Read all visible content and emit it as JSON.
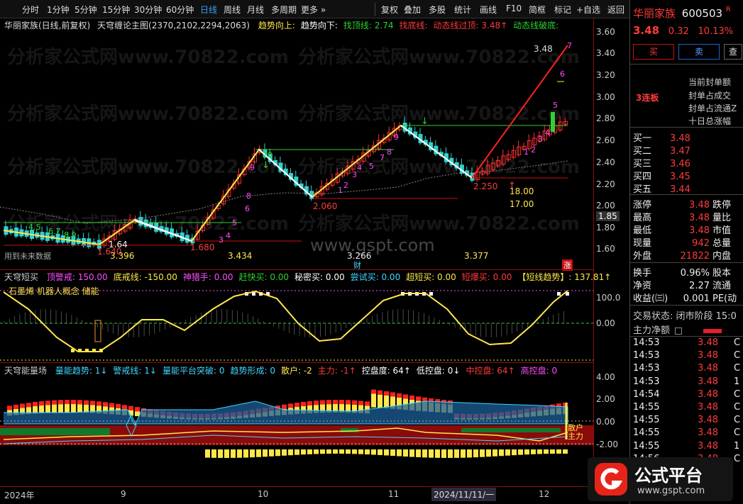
{
  "toolbar": {
    "periods": [
      "分时",
      "1分钟",
      "5分钟",
      "15分钟",
      "30分钟",
      "60分钟",
      "日线",
      "周线",
      "月线",
      "多周期",
      "更多 »"
    ],
    "active_period": "日线",
    "right_buttons": [
      "复权",
      "叠加",
      "多股",
      "统计",
      "画线",
      "F10",
      "简框",
      "标记",
      "+自选",
      "返回"
    ]
  },
  "main_chart": {
    "header": "华丽家族(日线,前复权)",
    "indicator_title": "天穹缠论主图(2370,2102,2294,2063)",
    "items": [
      {
        "text": "趋势向上:",
        "color": "#ffe74a"
      },
      {
        "text": "趋势向下:",
        "color": "#ffffff"
      },
      {
        "text": "找顶线: 2.74",
        "color": "#2fd12f"
      },
      {
        "text": "找底线:",
        "color": "#ff3b3b"
      },
      {
        "text": "动态线过顶: 3.48↑",
        "color": "#ff3b3b"
      },
      {
        "text": "动态线破底:",
        "color": "#2fd12f"
      }
    ],
    "y_ticks": [
      "3.60",
      "3.40",
      "3.20",
      "3.00",
      "2.80",
      "2.60",
      "2.40",
      "2.20",
      "2.00",
      "1.80",
      "1.60"
    ],
    "current_price_tag": "1.85",
    "annotations": {
      "high_348": "3.48",
      "p_220": "2.20",
      "p_2250": "2.250",
      "p_2060": "2.060",
      "p_1680": "1.680",
      "p_164": "1.64",
      "p_1640": "1.640",
      "target1": "18.00",
      "target2": "17.00",
      "v_3396": "3.396",
      "v_3434": "3.434",
      "v_3266": "3.266",
      "v_3377": "3.377",
      "cai": "财",
      "future_data": "用到未来数据",
      "zhangting": "涨"
    },
    "watermark_url": "www.gspt.com"
  },
  "chart_data": [
    {
      "type": "line",
      "title": "天穹缠论主图",
      "series": [
        {
          "name": "趋势向上",
          "x": [
            "9",
            "10",
            "11",
            "12"
          ],
          "values": [
            2.55,
            2.06,
            2.73,
            3.48
          ]
        }
      ],
      "ylim": [
        1.55,
        3.65
      ]
    },
    {
      "type": "line",
      "title": "天穹短买",
      "ylim": [
        -20,
        140
      ],
      "x": [
        "9",
        "10",
        "11",
        "12"
      ],
      "series": [
        {
          "name": "天穹短买",
          "values": [
            0,
            100,
            30,
            100
          ]
        }
      ]
    },
    {
      "type": "bar",
      "title": "天穹能量场",
      "ylim": [
        -3,
        4.5
      ],
      "x": [
        "9",
        "10",
        "11",
        "12"
      ],
      "series": [
        {
          "name": "天穹能量场",
          "values": [
            0.9,
            1.4,
            3.2,
            0.8
          ]
        }
      ]
    }
  ],
  "sub1": {
    "title": "天穹短买",
    "items": [
      {
        "text": "顶警戒: 150.00",
        "color": "#ff4dff"
      },
      {
        "text": "底戒线: -150.00",
        "color": "#ffe74a"
      },
      {
        "text": "神猎手: 0.00",
        "color": "#ff4dff"
      },
      {
        "text": "赶快买: 0.00",
        "color": "#2fd12f"
      },
      {
        "text": "秘密买: 0.00",
        "color": "#ffffff"
      },
      {
        "text": "尝试买: 0.00",
        "color": "#3fd7ff"
      },
      {
        "text": "超短买: 0.00",
        "color": "#ffe74a"
      },
      {
        "text": "短爆买: 0.00",
        "color": "#ff3b3b"
      },
      {
        "text": "【短线趋势】: 137.81↑",
        "color": "#ffe74a"
      }
    ],
    "tag": "石墨烯 机器人概念 储能",
    "y_ticks": [
      "100.0",
      "0.00"
    ]
  },
  "sub2": {
    "title": "天穹能量场",
    "items": [
      {
        "text": "量能趋势: 1↓",
        "color": "#3fd7ff"
      },
      {
        "text": "警戒线: 1↓",
        "color": "#3fd7ff"
      },
      {
        "text": "量能平台突破: 0",
        "color": "#3fd7ff"
      },
      {
        "text": "趋势形成: 0",
        "color": "#3fd7ff"
      },
      {
        "text": "散户: -2",
        "color": "#ffe74a"
      },
      {
        "text": "主力: -1↑",
        "color": "#ff3b3b"
      },
      {
        "text": "控盘度: 64↑",
        "color": "#ffffff"
      },
      {
        "text": "低控盘: 0↓",
        "color": "#ffffff"
      },
      {
        "text": "中控盘: 64↑",
        "color": "#ff3b3b"
      },
      {
        "text": "高控盘: 0",
        "color": "#ff4dff"
      }
    ],
    "y_ticks": [
      "4.00",
      "2.00",
      "0.00",
      "-2.00"
    ],
    "side_labels": "散户 主力"
  },
  "xaxis": {
    "labels": [
      "2024年",
      "9",
      "10",
      "11",
      "2024/11/11/一",
      "12"
    ]
  },
  "rpanel": {
    "stock_name": "华丽家族",
    "stock_code": "600503",
    "r_badge": "R",
    "price": "3.48",
    "change": "0.32",
    "pct": "10.13%",
    "buy_label": "买",
    "sell_label": "卖",
    "other_label": "查",
    "limit_info": [
      "当前封单额",
      "封单占成交",
      "封单占流通Z",
      "十日总涨幅"
    ],
    "lianban": "3连板",
    "bid": [
      {
        "label": "买一",
        "price": "3.48"
      },
      {
        "label": "买二",
        "price": "3.47"
      },
      {
        "label": "买三",
        "price": "3.46"
      },
      {
        "label": "买四",
        "price": "3.45"
      },
      {
        "label": "买五",
        "price": "3.44"
      }
    ],
    "stats": [
      {
        "label": "涨停",
        "value": "3.48",
        "label2": "跌停"
      },
      {
        "label": "最高",
        "value": "3.48",
        "label2": "量比"
      },
      {
        "label": "最低",
        "value": "3.48",
        "label2": "市值"
      },
      {
        "label": "现量",
        "value": "942",
        "label2": "总量"
      },
      {
        "label": "外盘",
        "value": "21822",
        "label2": "内盘"
      }
    ],
    "stats2": [
      {
        "label": "换手",
        "value": "0.96%",
        "label2": "股本"
      },
      {
        "label": "净资",
        "value": "2.27",
        "label2": "流通"
      },
      {
        "label": "收益(㈢)",
        "value": "0.001",
        "label2": "PE(动"
      }
    ],
    "trade_status": "交易状态: 闭市阶段 15:0",
    "zhuli_label": "主力净额",
    "ticks": [
      {
        "time": "14:53",
        "price": "3.48",
        "flag": "C"
      },
      {
        "time": "14:53",
        "price": "3.48",
        "flag": "C"
      },
      {
        "time": "14:53",
        "price": "3.48",
        "flag": "C"
      },
      {
        "time": "14:53",
        "price": "3.48",
        "flag": "1"
      },
      {
        "time": "14:54",
        "price": "3.48",
        "flag": "C"
      },
      {
        "time": "14:55",
        "price": "3.48",
        "flag": "C"
      },
      {
        "time": "14:55",
        "price": "3.48",
        "flag": "C"
      },
      {
        "time": "14:55",
        "price": "3.48",
        "flag": "C"
      },
      {
        "time": "14:55",
        "price": "3.48",
        "flag": "1"
      },
      {
        "time": "14:56",
        "price": "3.48",
        "flag": "C"
      }
    ],
    "logo_text": "公式平台",
    "logo_url": "www.gspt.com"
  }
}
